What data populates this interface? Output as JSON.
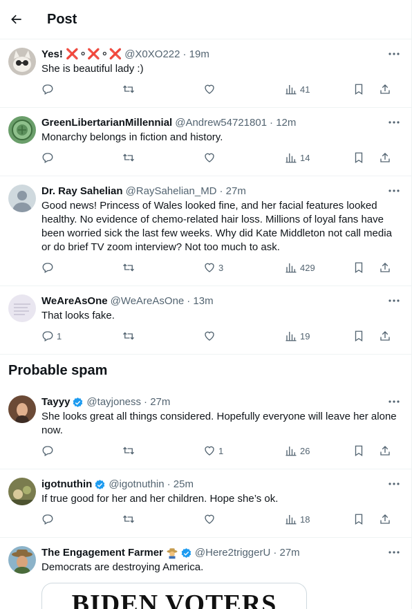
{
  "header": {
    "title": "Post"
  },
  "section": {
    "probable_spam": "Probable spam"
  },
  "tweets": [
    {
      "name": "Yes! ❌⚬❌⚬❌",
      "handle": "@X0XO222",
      "time": "· 19m",
      "verified": false,
      "text": "She is beautiful lady :)",
      "replies": "",
      "reposts": "",
      "likes": "",
      "views": "41"
    },
    {
      "name": "GreenLibertarianMillennial",
      "handle": "@Andrew54721801",
      "time": "· 12m",
      "verified": false,
      "text": "Monarchy belongs in fiction and history.",
      "replies": "",
      "reposts": "",
      "likes": "",
      "views": "14"
    },
    {
      "name": "Dr. Ray Sahelian",
      "handle": "@RaySahelian_MD",
      "time": "· 27m",
      "verified": false,
      "text": "Good news! Princess of Wales looked fine, and her facial features looked healthy. No evidence of chemo-related hair loss. Millions of loyal fans have been worried sick the last few weeks. Why did Kate Middleton not call media or do brief TV zoom interview? Not too much to ask.",
      "replies": "",
      "reposts": "",
      "likes": "3",
      "views": "429"
    },
    {
      "name": "WeAreAsOne",
      "handle": "@WeAreAsOne",
      "time": "· 13m",
      "verified": false,
      "text": "That looks fake.",
      "replies": "1",
      "reposts": "",
      "likes": "",
      "views": "19"
    },
    {
      "name": "Tayyy",
      "handle": "@tayjoness",
      "time": "· 27m",
      "verified": true,
      "text": "She looks great all things considered. Hopefully everyone will leave her alone now.",
      "replies": "",
      "reposts": "",
      "likes": "1",
      "views": "26"
    },
    {
      "name": "igotnuthin",
      "handle": "@igotnuthin",
      "time": "· 25m",
      "verified": true,
      "text": "If true good for her and her children.  Hope she’s ok.",
      "replies": "",
      "reposts": "",
      "likes": "",
      "views": "18"
    },
    {
      "name": "The Engagement Farmer",
      "handle": "@Here2triggerU",
      "time": "· 27m",
      "verified": true,
      "text": "Democrats are destroying America.",
      "media_text": "BIDEN VOTERS"
    }
  ],
  "colors": {
    "text": "#0f1419",
    "secondary": "#536471",
    "border": "#eff3f4",
    "verified": "#1d9bf0"
  }
}
